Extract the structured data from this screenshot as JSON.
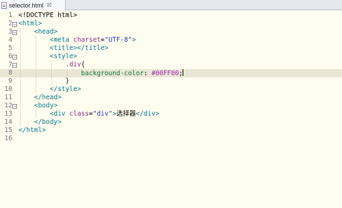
{
  "tab": {
    "filename": "selector.html",
    "close_glyph": "☒"
  },
  "lines": [
    {
      "n": "1",
      "fold": false,
      "tokens": [
        {
          "t": "<!DOCTYPE html>",
          "c": "text"
        }
      ]
    },
    {
      "n": "2",
      "fold": true,
      "tokens": [
        {
          "t": "<html>",
          "c": "tag"
        }
      ]
    },
    {
      "n": "3",
      "fold": true,
      "tokens": [
        {
          "t": "    ",
          "c": "text"
        },
        {
          "t": "<head>",
          "c": "tag"
        }
      ]
    },
    {
      "n": "4",
      "fold": false,
      "tokens": [
        {
          "t": "        ",
          "c": "text"
        },
        {
          "t": "<meta",
          "c": "tag"
        },
        {
          "t": " ",
          "c": "text"
        },
        {
          "t": "charset",
          "c": "attr"
        },
        {
          "t": "=",
          "c": "text"
        },
        {
          "t": "\"UTF-8\"",
          "c": "str"
        },
        {
          "t": ">",
          "c": "tag"
        }
      ]
    },
    {
      "n": "5",
      "fold": false,
      "tokens": [
        {
          "t": "        ",
          "c": "text"
        },
        {
          "t": "<title></title>",
          "c": "tag"
        }
      ]
    },
    {
      "n": "6",
      "fold": true,
      "tokens": [
        {
          "t": "        ",
          "c": "text"
        },
        {
          "t": "<style>",
          "c": "tag"
        }
      ]
    },
    {
      "n": "7",
      "fold": true,
      "tokens": [
        {
          "t": "            ",
          "c": "text"
        },
        {
          "t": ".div",
          "c": "sel"
        },
        {
          "t": "{",
          "c": "brace"
        }
      ]
    },
    {
      "n": "8",
      "fold": false,
      "current": true,
      "cursor": true,
      "tokens": [
        {
          "t": "                ",
          "c": "text"
        },
        {
          "t": "background-color",
          "c": "prop"
        },
        {
          "t": ": ",
          "c": "text"
        },
        {
          "t": "#00FF00",
          "c": "val"
        },
        {
          "t": ";",
          "c": "text"
        }
      ]
    },
    {
      "n": "9",
      "fold": false,
      "tokens": [
        {
          "t": "            ",
          "c": "text"
        },
        {
          "t": "}",
          "c": "brace"
        }
      ]
    },
    {
      "n": "10",
      "fold": false,
      "tokens": [
        {
          "t": "        ",
          "c": "text"
        },
        {
          "t": "</style>",
          "c": "tag"
        }
      ]
    },
    {
      "n": "11",
      "fold": false,
      "tokens": [
        {
          "t": "    ",
          "c": "text"
        },
        {
          "t": "</head>",
          "c": "tag"
        }
      ]
    },
    {
      "n": "12",
      "fold": true,
      "tokens": [
        {
          "t": "    ",
          "c": "text"
        },
        {
          "t": "<body>",
          "c": "tag"
        }
      ]
    },
    {
      "n": "13",
      "fold": false,
      "tokens": [
        {
          "t": "        ",
          "c": "text"
        },
        {
          "t": "<div",
          "c": "tag"
        },
        {
          "t": " ",
          "c": "text"
        },
        {
          "t": "class",
          "c": "attr"
        },
        {
          "t": "=",
          "c": "text"
        },
        {
          "t": "\"div\"",
          "c": "str"
        },
        {
          "t": ">",
          "c": "tag"
        },
        {
          "t": "选择器",
          "c": "text"
        },
        {
          "t": "</div>",
          "c": "tag"
        }
      ]
    },
    {
      "n": "14",
      "fold": false,
      "tokens": [
        {
          "t": "    ",
          "c": "text"
        },
        {
          "t": "</body>",
          "c": "tag"
        }
      ]
    },
    {
      "n": "15",
      "fold": false,
      "tokens": [
        {
          "t": "</html>",
          "c": "tag"
        }
      ]
    },
    {
      "n": "16",
      "fold": false,
      "tokens": []
    }
  ]
}
